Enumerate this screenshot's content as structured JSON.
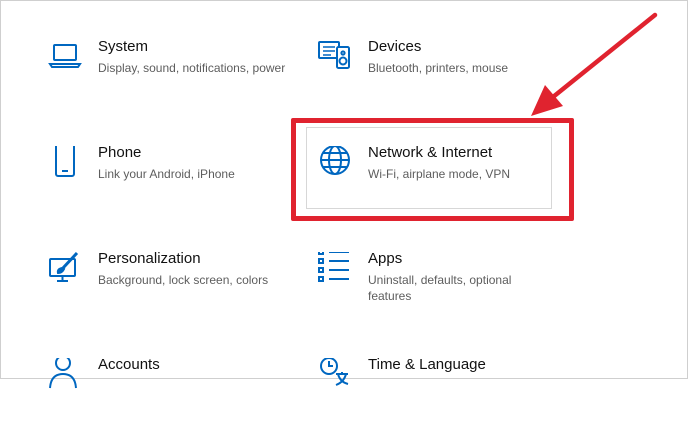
{
  "accent_color": "#0067c0",
  "annotation_color": "#e0232f",
  "tiles": [
    {
      "title": "System",
      "desc": "Display, sound, notifications, power",
      "icon": "laptop-icon"
    },
    {
      "title": "Devices",
      "desc": "Bluetooth, printers, mouse",
      "icon": "devices-icon"
    },
    {
      "title": "Phone",
      "desc": "Link your Android, iPhone",
      "icon": "phone-icon"
    },
    {
      "title": "Network & Internet",
      "desc": "Wi-Fi, airplane mode, VPN",
      "icon": "globe-icon"
    },
    {
      "title": "Personalization",
      "desc": "Background, lock screen, colors",
      "icon": "personalization-icon"
    },
    {
      "title": "Apps",
      "desc": "Uninstall, defaults, optional features",
      "icon": "apps-icon"
    },
    {
      "title": "Accounts",
      "desc": "",
      "icon": "person-icon"
    },
    {
      "title": "Time & Language",
      "desc": "",
      "icon": "time-language-icon"
    }
  ]
}
